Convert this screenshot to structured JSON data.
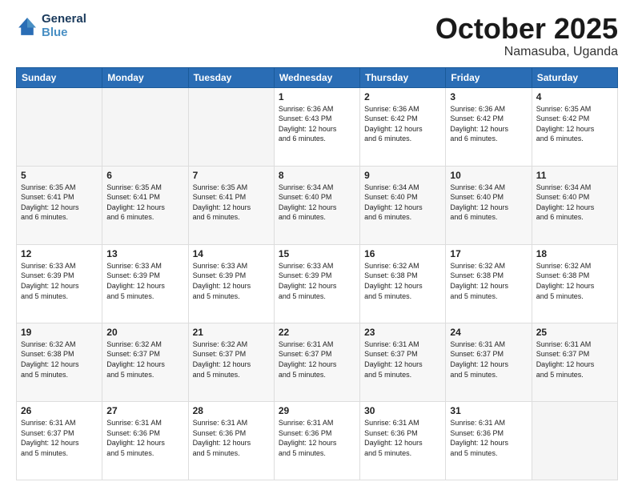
{
  "logo": {
    "line1": "General",
    "line2": "Blue"
  },
  "title": "October 2025",
  "subtitle": "Namasuba, Uganda",
  "weekdays": [
    "Sunday",
    "Monday",
    "Tuesday",
    "Wednesday",
    "Thursday",
    "Friday",
    "Saturday"
  ],
  "weeks": [
    {
      "rowClass": "week-row-1",
      "days": [
        {
          "num": "",
          "info": "",
          "empty": true
        },
        {
          "num": "",
          "info": "",
          "empty": true
        },
        {
          "num": "",
          "info": "",
          "empty": true
        },
        {
          "num": "1",
          "info": "Sunrise: 6:36 AM\nSunset: 6:43 PM\nDaylight: 12 hours\nand 6 minutes.",
          "empty": false
        },
        {
          "num": "2",
          "info": "Sunrise: 6:36 AM\nSunset: 6:42 PM\nDaylight: 12 hours\nand 6 minutes.",
          "empty": false
        },
        {
          "num": "3",
          "info": "Sunrise: 6:36 AM\nSunset: 6:42 PM\nDaylight: 12 hours\nand 6 minutes.",
          "empty": false
        },
        {
          "num": "4",
          "info": "Sunrise: 6:35 AM\nSunset: 6:42 PM\nDaylight: 12 hours\nand 6 minutes.",
          "empty": false
        }
      ]
    },
    {
      "rowClass": "week-row-2",
      "days": [
        {
          "num": "5",
          "info": "Sunrise: 6:35 AM\nSunset: 6:41 PM\nDaylight: 12 hours\nand 6 minutes.",
          "empty": false
        },
        {
          "num": "6",
          "info": "Sunrise: 6:35 AM\nSunset: 6:41 PM\nDaylight: 12 hours\nand 6 minutes.",
          "empty": false
        },
        {
          "num": "7",
          "info": "Sunrise: 6:35 AM\nSunset: 6:41 PM\nDaylight: 12 hours\nand 6 minutes.",
          "empty": false
        },
        {
          "num": "8",
          "info": "Sunrise: 6:34 AM\nSunset: 6:40 PM\nDaylight: 12 hours\nand 6 minutes.",
          "empty": false
        },
        {
          "num": "9",
          "info": "Sunrise: 6:34 AM\nSunset: 6:40 PM\nDaylight: 12 hours\nand 6 minutes.",
          "empty": false
        },
        {
          "num": "10",
          "info": "Sunrise: 6:34 AM\nSunset: 6:40 PM\nDaylight: 12 hours\nand 6 minutes.",
          "empty": false
        },
        {
          "num": "11",
          "info": "Sunrise: 6:34 AM\nSunset: 6:40 PM\nDaylight: 12 hours\nand 6 minutes.",
          "empty": false
        }
      ]
    },
    {
      "rowClass": "week-row-3",
      "days": [
        {
          "num": "12",
          "info": "Sunrise: 6:33 AM\nSunset: 6:39 PM\nDaylight: 12 hours\nand 5 minutes.",
          "empty": false
        },
        {
          "num": "13",
          "info": "Sunrise: 6:33 AM\nSunset: 6:39 PM\nDaylight: 12 hours\nand 5 minutes.",
          "empty": false
        },
        {
          "num": "14",
          "info": "Sunrise: 6:33 AM\nSunset: 6:39 PM\nDaylight: 12 hours\nand 5 minutes.",
          "empty": false
        },
        {
          "num": "15",
          "info": "Sunrise: 6:33 AM\nSunset: 6:39 PM\nDaylight: 12 hours\nand 5 minutes.",
          "empty": false
        },
        {
          "num": "16",
          "info": "Sunrise: 6:32 AM\nSunset: 6:38 PM\nDaylight: 12 hours\nand 5 minutes.",
          "empty": false
        },
        {
          "num": "17",
          "info": "Sunrise: 6:32 AM\nSunset: 6:38 PM\nDaylight: 12 hours\nand 5 minutes.",
          "empty": false
        },
        {
          "num": "18",
          "info": "Sunrise: 6:32 AM\nSunset: 6:38 PM\nDaylight: 12 hours\nand 5 minutes.",
          "empty": false
        }
      ]
    },
    {
      "rowClass": "week-row-4",
      "days": [
        {
          "num": "19",
          "info": "Sunrise: 6:32 AM\nSunset: 6:38 PM\nDaylight: 12 hours\nand 5 minutes.",
          "empty": false
        },
        {
          "num": "20",
          "info": "Sunrise: 6:32 AM\nSunset: 6:37 PM\nDaylight: 12 hours\nand 5 minutes.",
          "empty": false
        },
        {
          "num": "21",
          "info": "Sunrise: 6:32 AM\nSunset: 6:37 PM\nDaylight: 12 hours\nand 5 minutes.",
          "empty": false
        },
        {
          "num": "22",
          "info": "Sunrise: 6:31 AM\nSunset: 6:37 PM\nDaylight: 12 hours\nand 5 minutes.",
          "empty": false
        },
        {
          "num": "23",
          "info": "Sunrise: 6:31 AM\nSunset: 6:37 PM\nDaylight: 12 hours\nand 5 minutes.",
          "empty": false
        },
        {
          "num": "24",
          "info": "Sunrise: 6:31 AM\nSunset: 6:37 PM\nDaylight: 12 hours\nand 5 minutes.",
          "empty": false
        },
        {
          "num": "25",
          "info": "Sunrise: 6:31 AM\nSunset: 6:37 PM\nDaylight: 12 hours\nand 5 minutes.",
          "empty": false
        }
      ]
    },
    {
      "rowClass": "week-row-5",
      "days": [
        {
          "num": "26",
          "info": "Sunrise: 6:31 AM\nSunset: 6:37 PM\nDaylight: 12 hours\nand 5 minutes.",
          "empty": false
        },
        {
          "num": "27",
          "info": "Sunrise: 6:31 AM\nSunset: 6:36 PM\nDaylight: 12 hours\nand 5 minutes.",
          "empty": false
        },
        {
          "num": "28",
          "info": "Sunrise: 6:31 AM\nSunset: 6:36 PM\nDaylight: 12 hours\nand 5 minutes.",
          "empty": false
        },
        {
          "num": "29",
          "info": "Sunrise: 6:31 AM\nSunset: 6:36 PM\nDaylight: 12 hours\nand 5 minutes.",
          "empty": false
        },
        {
          "num": "30",
          "info": "Sunrise: 6:31 AM\nSunset: 6:36 PM\nDaylight: 12 hours\nand 5 minutes.",
          "empty": false
        },
        {
          "num": "31",
          "info": "Sunrise: 6:31 AM\nSunset: 6:36 PM\nDaylight: 12 hours\nand 5 minutes.",
          "empty": false
        },
        {
          "num": "",
          "info": "",
          "empty": true
        }
      ]
    }
  ]
}
